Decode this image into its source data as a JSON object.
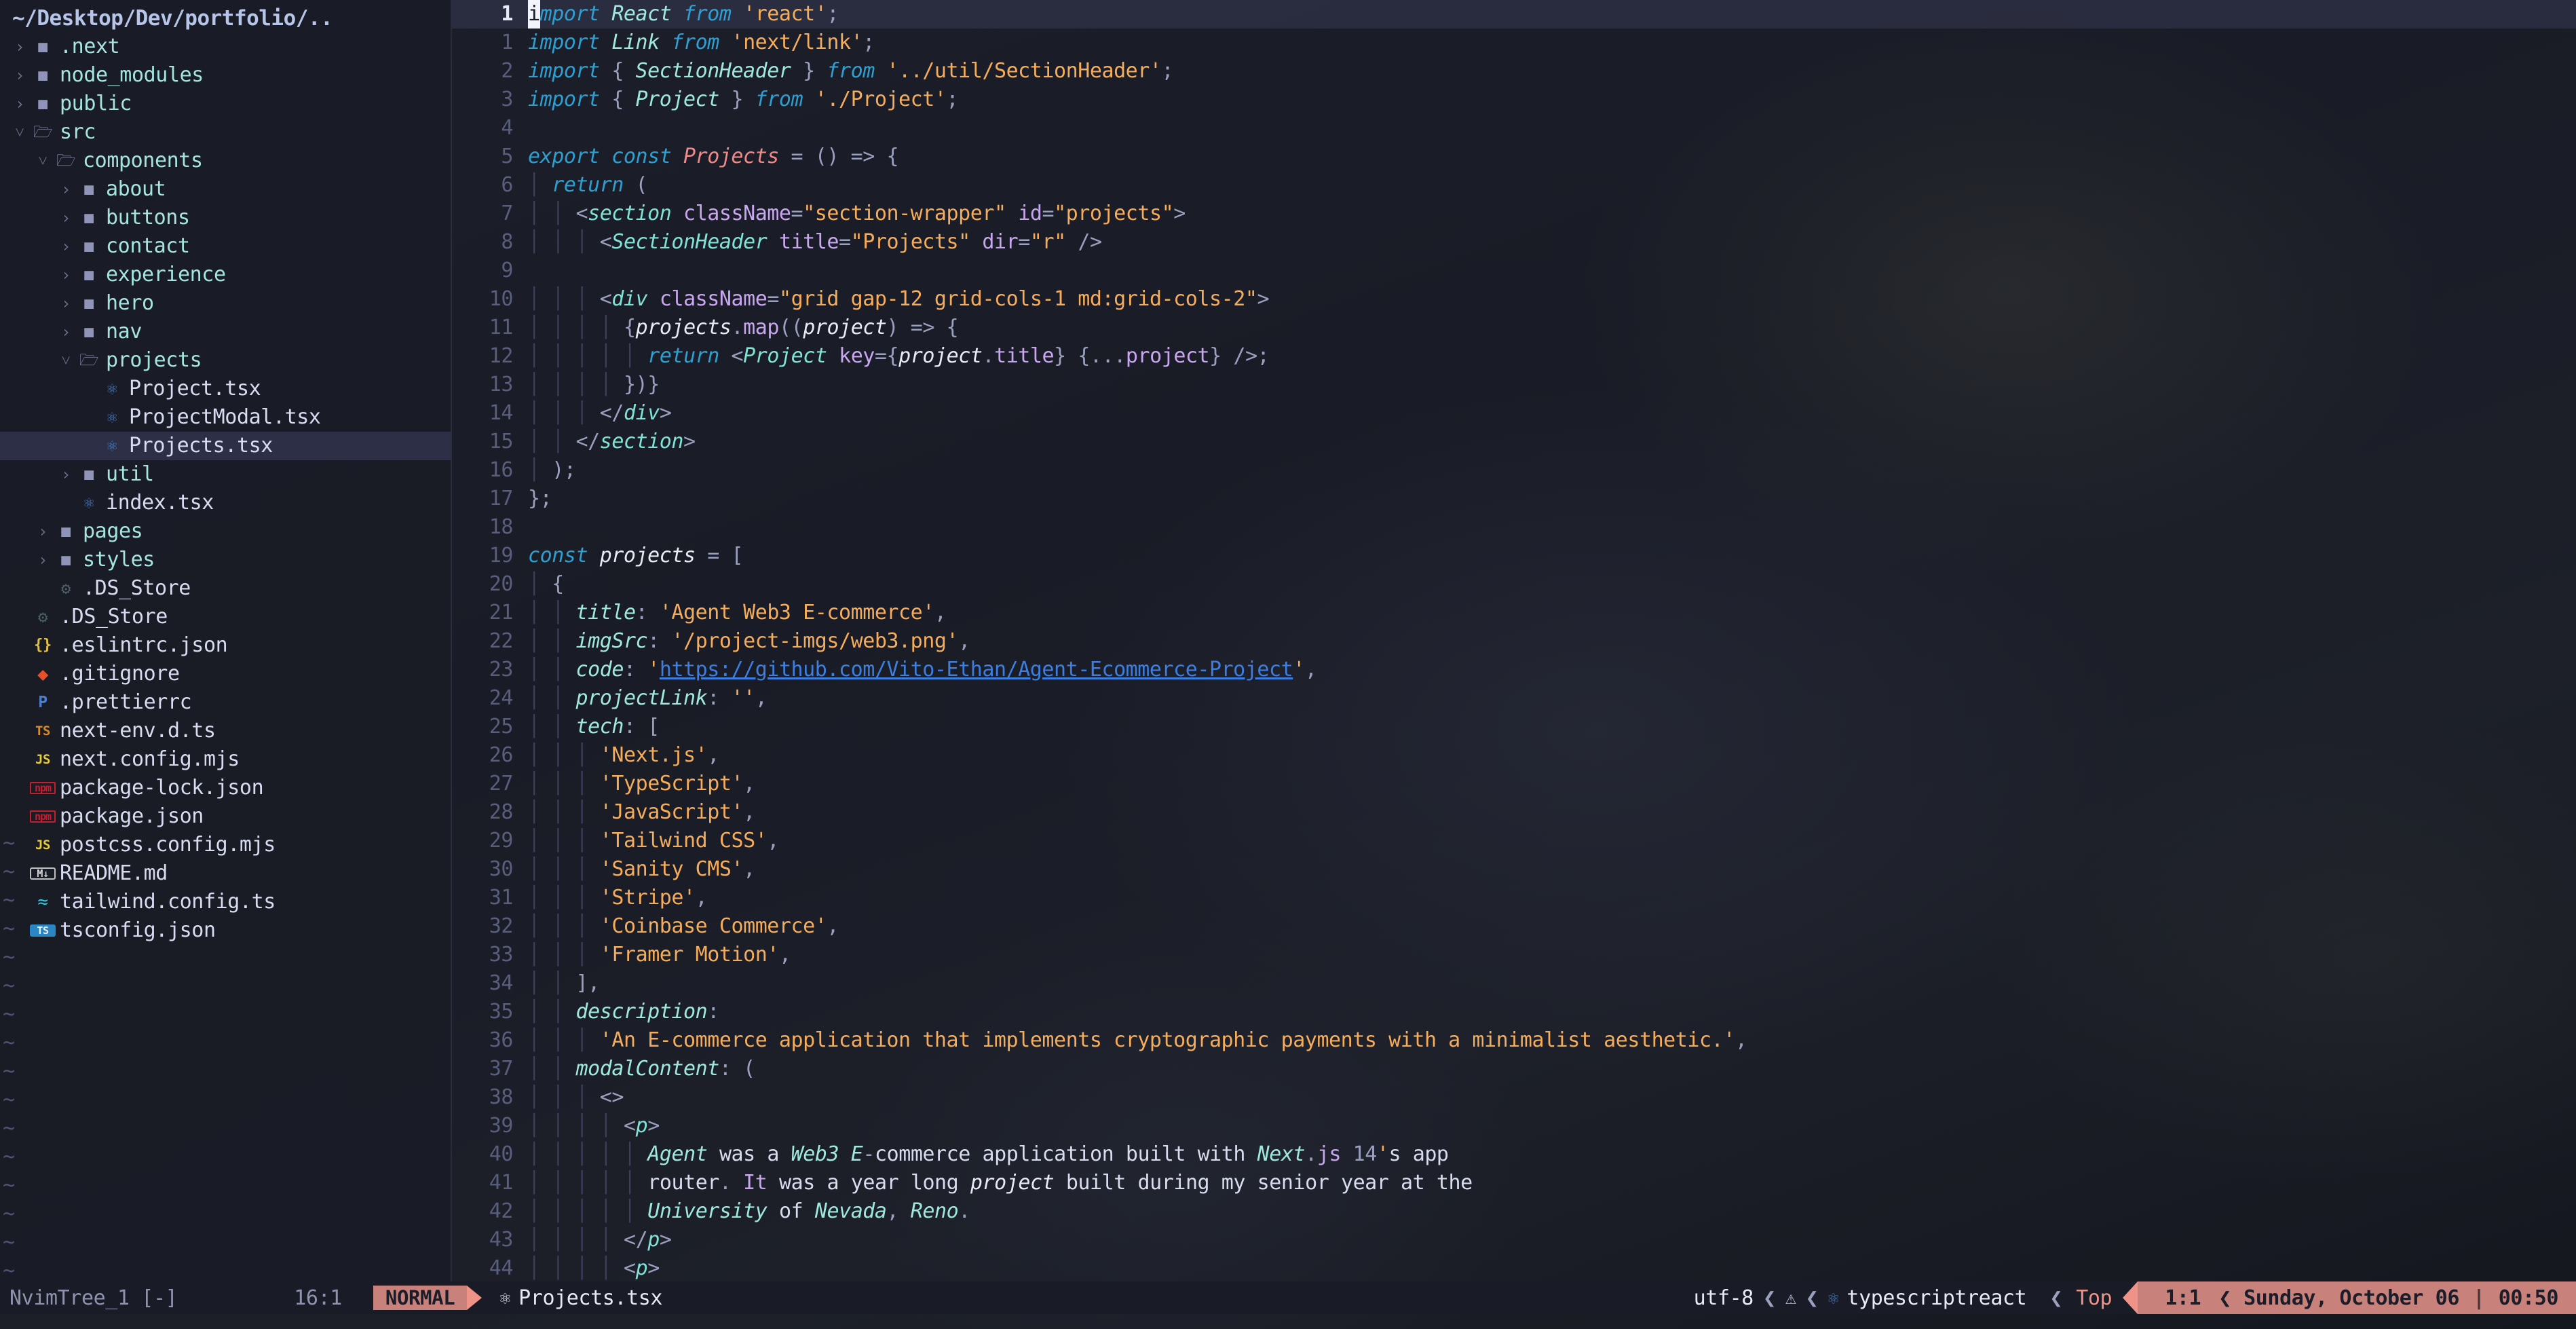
{
  "sidebar": {
    "root_label": "~/Desktop/Dev/portfolio/..",
    "items": [
      {
        "label": ".next",
        "type": "dir",
        "indent": 1,
        "expanded": false,
        "icon": "folder-closed-icon"
      },
      {
        "label": "node_modules",
        "type": "dir",
        "indent": 1,
        "expanded": false,
        "icon": "folder-closed-icon"
      },
      {
        "label": "public",
        "type": "dir",
        "indent": 1,
        "expanded": false,
        "icon": "folder-closed-icon"
      },
      {
        "label": "src",
        "type": "dir",
        "indent": 1,
        "expanded": true,
        "icon": "folder-open-icon"
      },
      {
        "label": "components",
        "type": "dir",
        "indent": 2,
        "expanded": true,
        "icon": "folder-open-icon"
      },
      {
        "label": "about",
        "type": "dir",
        "indent": 3,
        "expanded": false,
        "icon": "folder-closed-icon"
      },
      {
        "label": "buttons",
        "type": "dir",
        "indent": 3,
        "expanded": false,
        "icon": "folder-closed-icon"
      },
      {
        "label": "contact",
        "type": "dir",
        "indent": 3,
        "expanded": false,
        "icon": "folder-closed-icon"
      },
      {
        "label": "experience",
        "type": "dir",
        "indent": 3,
        "expanded": false,
        "icon": "folder-closed-icon"
      },
      {
        "label": "hero",
        "type": "dir",
        "indent": 3,
        "expanded": false,
        "icon": "folder-closed-icon"
      },
      {
        "label": "nav",
        "type": "dir",
        "indent": 3,
        "expanded": false,
        "icon": "folder-closed-icon"
      },
      {
        "label": "projects",
        "type": "dir",
        "indent": 3,
        "expanded": true,
        "icon": "folder-open-icon"
      },
      {
        "label": "Project.tsx",
        "type": "file",
        "indent": 4,
        "icon": "react-icon"
      },
      {
        "label": "ProjectModal.tsx",
        "type": "file",
        "indent": 4,
        "icon": "react-icon"
      },
      {
        "label": "Projects.tsx",
        "type": "file",
        "indent": 4,
        "icon": "react-icon",
        "selected": true
      },
      {
        "label": "util",
        "type": "dir",
        "indent": 3,
        "expanded": false,
        "icon": "folder-closed-icon"
      },
      {
        "label": "index.tsx",
        "type": "file",
        "indent": 3,
        "icon": "react-icon"
      },
      {
        "label": "pages",
        "type": "dir",
        "indent": 2,
        "expanded": false,
        "icon": "folder-closed-icon"
      },
      {
        "label": "styles",
        "type": "dir",
        "indent": 2,
        "expanded": false,
        "icon": "folder-closed-icon"
      },
      {
        "label": ".DS_Store",
        "type": "file",
        "indent": 2,
        "icon": "gear-icon"
      },
      {
        "label": ".DS_Store",
        "type": "file",
        "indent": 1,
        "icon": "gear-icon"
      },
      {
        "label": ".eslintrc.json",
        "type": "file",
        "indent": 1,
        "icon": "json-braces-icon"
      },
      {
        "label": ".gitignore",
        "type": "file",
        "indent": 1,
        "icon": "git-icon"
      },
      {
        "label": ".prettierrc",
        "type": "file",
        "indent": 1,
        "icon": "prettier-icon"
      },
      {
        "label": "next-env.d.ts",
        "type": "file",
        "indent": 1,
        "icon": "typescript-icon"
      },
      {
        "label": "next.config.mjs",
        "type": "file",
        "indent": 1,
        "icon": "javascript-icon"
      },
      {
        "label": "package-lock.json",
        "type": "file",
        "indent": 1,
        "icon": "npm-icon"
      },
      {
        "label": "package.json",
        "type": "file",
        "indent": 1,
        "icon": "npm-icon"
      },
      {
        "label": "postcss.config.mjs",
        "type": "file",
        "indent": 1,
        "icon": "javascript-icon"
      },
      {
        "label": "README.md",
        "type": "file",
        "indent": 1,
        "icon": "markdown-icon"
      },
      {
        "label": "tailwind.config.ts",
        "type": "file",
        "indent": 1,
        "icon": "tailwind-icon"
      },
      {
        "label": "tsconfig.json",
        "type": "file",
        "indent": 1,
        "icon": "tsconfig-icon"
      }
    ],
    "filler_tilde": "~"
  },
  "editor": {
    "cursor_line": 1,
    "lines": [
      {
        "n": "1",
        "current": true
      },
      {
        "n": "1"
      },
      {
        "n": "2"
      },
      {
        "n": "3"
      },
      {
        "n": "4"
      },
      {
        "n": "5"
      },
      {
        "n": "6"
      },
      {
        "n": "7"
      },
      {
        "n": "8"
      },
      {
        "n": "9"
      },
      {
        "n": "10"
      },
      {
        "n": "11"
      },
      {
        "n": "12"
      },
      {
        "n": "13"
      },
      {
        "n": "14"
      },
      {
        "n": "15"
      },
      {
        "n": "16"
      },
      {
        "n": "17"
      },
      {
        "n": "18"
      },
      {
        "n": "19"
      },
      {
        "n": "20"
      },
      {
        "n": "21"
      },
      {
        "n": "22"
      },
      {
        "n": "23"
      },
      {
        "n": "24"
      },
      {
        "n": "25"
      },
      {
        "n": "26"
      },
      {
        "n": "27"
      },
      {
        "n": "28"
      },
      {
        "n": "29"
      },
      {
        "n": "30"
      },
      {
        "n": "31"
      },
      {
        "n": "32"
      },
      {
        "n": "33"
      },
      {
        "n": "34"
      },
      {
        "n": "35"
      },
      {
        "n": "36"
      },
      {
        "n": "37"
      },
      {
        "n": "38"
      },
      {
        "n": "39"
      },
      {
        "n": "40"
      },
      {
        "n": "41"
      },
      {
        "n": "42"
      },
      {
        "n": "43"
      },
      {
        "n": "44"
      }
    ],
    "source_text": [
      "import React from 'react';",
      "import Link from 'next/link';",
      "import { SectionHeader } from '../util/SectionHeader';",
      "import { Project } from './Project';",
      "",
      "export const Projects = () => {",
      "  return (",
      "    <section className=\"section-wrapper\" id=\"projects\">",
      "      <SectionHeader title=\"Projects\" dir=\"r\" />",
      "",
      "      <div className=\"grid gap-12 grid-cols-1 md:grid-cols-2\">",
      "        {projects.map((project) => {",
      "          return <Project key={project.title} {...project} />;",
      "        })}",
      "      </div>",
      "    </section>",
      "  );",
      "};",
      "",
      "const projects = [",
      "  {",
      "    title: 'Agent Web3 E-commerce',",
      "    imgSrc: '/project-imgs/web3.png',",
      "    code: 'https://github.com/Vito-Ethan/Agent-Ecommerce-Project',",
      "    projectLink: '',",
      "    tech: [",
      "      'Next.js',",
      "      'TypeScript',",
      "      'JavaScript',",
      "      'Tailwind CSS',",
      "      'Sanity CMS',",
      "      'Stripe',",
      "      'Coinbase Commerce',",
      "      'Framer Motion',",
      "    ],",
      "    description:",
      "      'An E-commerce application that implements cryptographic payments with a minimalist aesthetic.',",
      "    modalContent: (",
      "      <>",
      "        <p>",
      "          Agent was a Web3 E-commerce application built with Next.js 14's app",
      "          router. It was a year long project built during my senior year at the",
      "          University of Nevada, Reno.",
      "        </p>",
      "        <p>"
    ],
    "url_in_code": "https://github.com/Vito-Ethan/Agent-Ecommerce-Project"
  },
  "statusline": {
    "tree_buffer_name": "NvimTree_1 [-]",
    "tree_position": "16:1",
    "mode": "NORMAL",
    "file_icon": "react-icon",
    "filename": "Projects.tsx",
    "encoding": "utf-8",
    "separator_left": "❮",
    "warn_icon": "warning-icon",
    "filetype_icon": "react-icon",
    "filetype": "typescriptreact",
    "scroll_position": "Top",
    "cursor_position": "1:1",
    "date": "Sunday, October 06",
    "divider": "|",
    "time": "00:50"
  },
  "colors": {
    "bg": "#191b26",
    "accent_salmon": "#ef9287",
    "mode_block": "#c9817c",
    "dir_text": "#a5e5e0",
    "file_text": "#d7dcf0",
    "string": "#f5ad5c",
    "keyword": "#2d9fd0",
    "tag": "#7fe3d6",
    "attr": "#c9a6f0",
    "class_name": "#f08a8a",
    "link": "#3d7fe0",
    "selected_row": "#2c2f45"
  }
}
